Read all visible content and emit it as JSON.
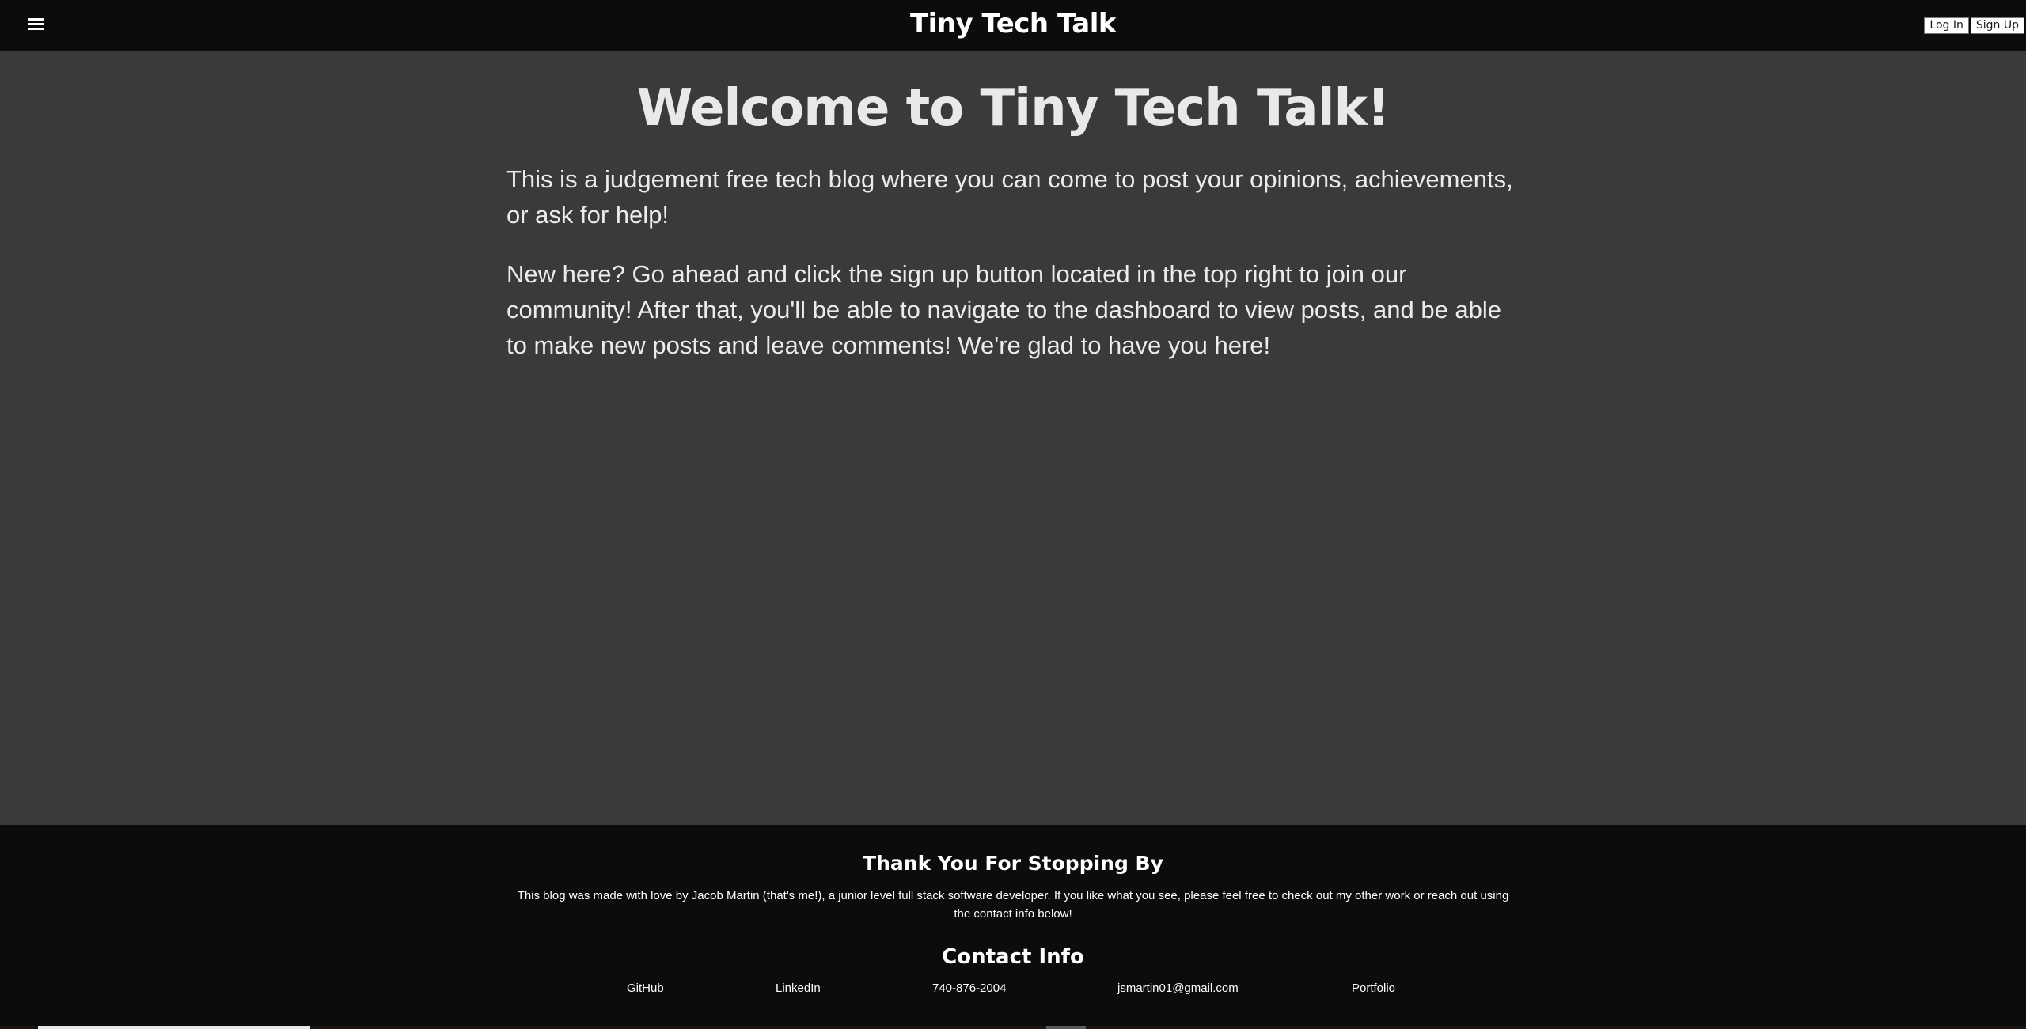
{
  "header": {
    "site_title": "Tiny Tech Talk",
    "menu_icon": "hamburger-menu-icon",
    "login_label": "Log In",
    "signup_label": "Sign Up"
  },
  "main": {
    "heading": "Welcome to Tiny Tech Talk!",
    "intro": "This is a judgement free tech blog where you can come to post your opinions, achievements, or ask for help!",
    "instructions": "New here? Go ahead and click the sign up button located in the top right to join our community! After that, you'll be able to navigate to the dashboard to view posts, and be able to make new posts and leave comments! We're glad to have you here!"
  },
  "footer": {
    "title": "Thank You For Stopping By",
    "text": "This blog was made with love by Jacob Martin (that's me!), a junior level full stack software developer. If you like what you see, please feel free to check out my other work or reach out using the contact info below!",
    "contact_title": "Contact Info",
    "links": [
      "GitHub",
      "LinkedIn",
      "740-876-2004",
      "jsmartin01@gmail.com",
      "Portfolio"
    ]
  },
  "colors": {
    "header_bg": "#0c0c0c",
    "page_bg": "#3a3a3a",
    "footer_bg": "#0c0c0c",
    "text": "#ececec"
  }
}
